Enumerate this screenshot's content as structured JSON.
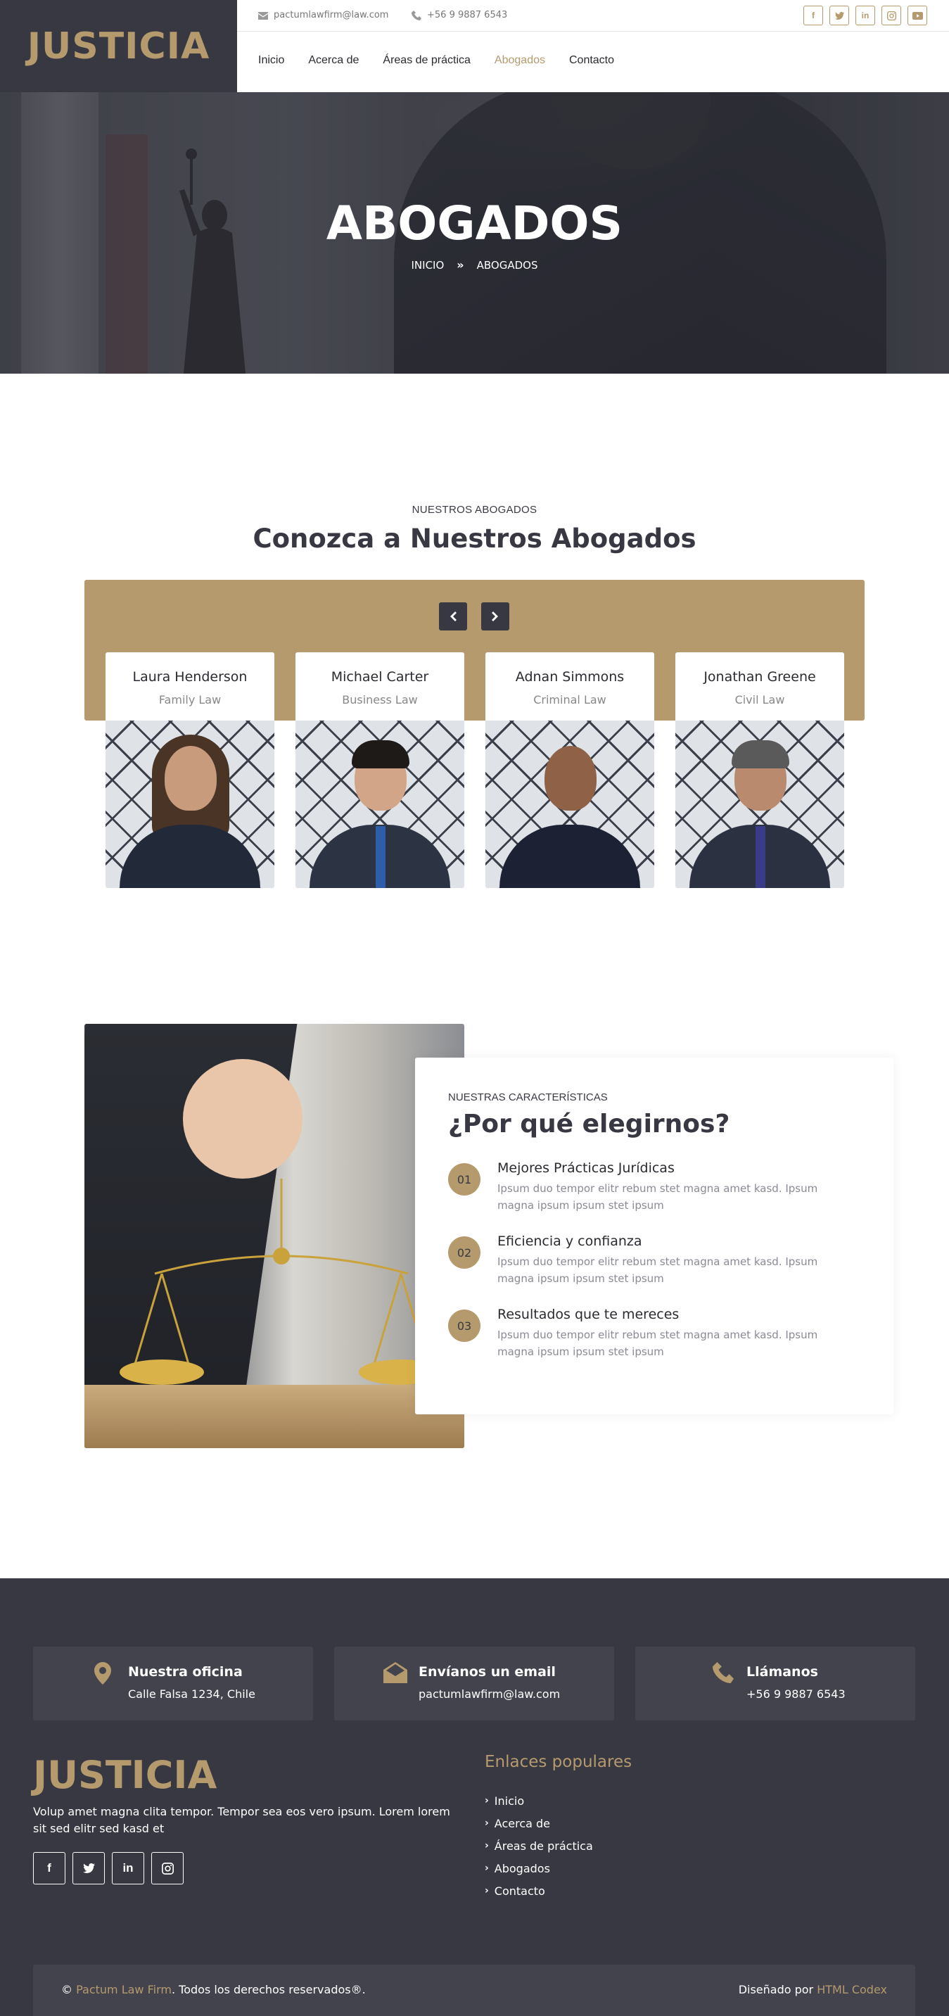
{
  "colors": {
    "accent": "#b59a6d",
    "dark": "#383842",
    "footer_box": "#43434d"
  },
  "header": {
    "logo": "JUSTICIA",
    "email": "pactumlawfirm@law.com",
    "phone": "+56 9 9887 6543",
    "socials": [
      "facebook-icon",
      "twitter-icon",
      "linkedin-icon",
      "instagram-icon",
      "youtube-icon"
    ],
    "nav": [
      {
        "label": "Inicio",
        "active": false
      },
      {
        "label": "Acerca de",
        "active": false
      },
      {
        "label": "Áreas de práctica",
        "active": false
      },
      {
        "label": "Abogados",
        "active": true
      },
      {
        "label": "Contacto",
        "active": false
      }
    ]
  },
  "hero": {
    "title": "ABOGADOS",
    "breadcrumb": [
      "INICIO",
      "ABOGADOS"
    ]
  },
  "team": {
    "eyebrow": "NUESTROS ABOGADOS",
    "title": "Conozca a Nuestros Abogados",
    "members": [
      {
        "name": "Laura Henderson",
        "role": "Family Law"
      },
      {
        "name": "Michael Carter",
        "role": "Business Law"
      },
      {
        "name": "Adnan Simmons",
        "role": "Criminal Law"
      },
      {
        "name": "Jonathan Greene",
        "role": "Civil Law"
      }
    ]
  },
  "why": {
    "eyebrow": "NUESTRAS CARACTERÍSTICAS",
    "title": "¿Por qué elegirnos?",
    "features": [
      {
        "num": "01",
        "title": "Mejores Prácticas Jurídicas",
        "desc": "Ipsum duo tempor elitr rebum stet magna amet kasd. Ipsum magna ipsum ipsum stet ipsum"
      },
      {
        "num": "02",
        "title": "Eficiencia y confianza",
        "desc": "Ipsum duo tempor elitr rebum stet magna amet kasd. Ipsum magna ipsum ipsum stet ipsum"
      },
      {
        "num": "03",
        "title": "Resultados que te mereces",
        "desc": "Ipsum duo tempor elitr rebum stet magna amet kasd. Ipsum magna ipsum ipsum stet ipsum"
      }
    ]
  },
  "footer": {
    "info": [
      {
        "icon": "map-marker-icon",
        "title": "Nuestra oficina",
        "value": "Calle Falsa 1234, Chile"
      },
      {
        "icon": "envelope-open-icon",
        "title": "Envíanos un email",
        "value": "pactumlawfirm@law.com"
      },
      {
        "icon": "phone-icon",
        "title": "Llámanos",
        "value": "+56 9 9887 6543"
      }
    ],
    "logo": "JUSTICIA",
    "description": "Volup amet magna clita tempor. Tempor sea eos vero ipsum. Lorem lorem sit sed elitr sed kasd et",
    "socials": [
      "facebook-icon",
      "twitter-icon",
      "linkedin-icon",
      "instagram-icon"
    ],
    "links_title": "Enlaces populares",
    "links": [
      "Inicio",
      "Acerca de",
      "Áreas de práctica",
      "Abogados",
      "Contacto"
    ],
    "copyright_symbol": "©",
    "copyright_brand": "Pactum Law Firm",
    "copyright_text": ". Todos los derechos reservados®.",
    "designed_by_prefix": "Diseñado por",
    "designed_by_brand": "HTML Codex"
  }
}
